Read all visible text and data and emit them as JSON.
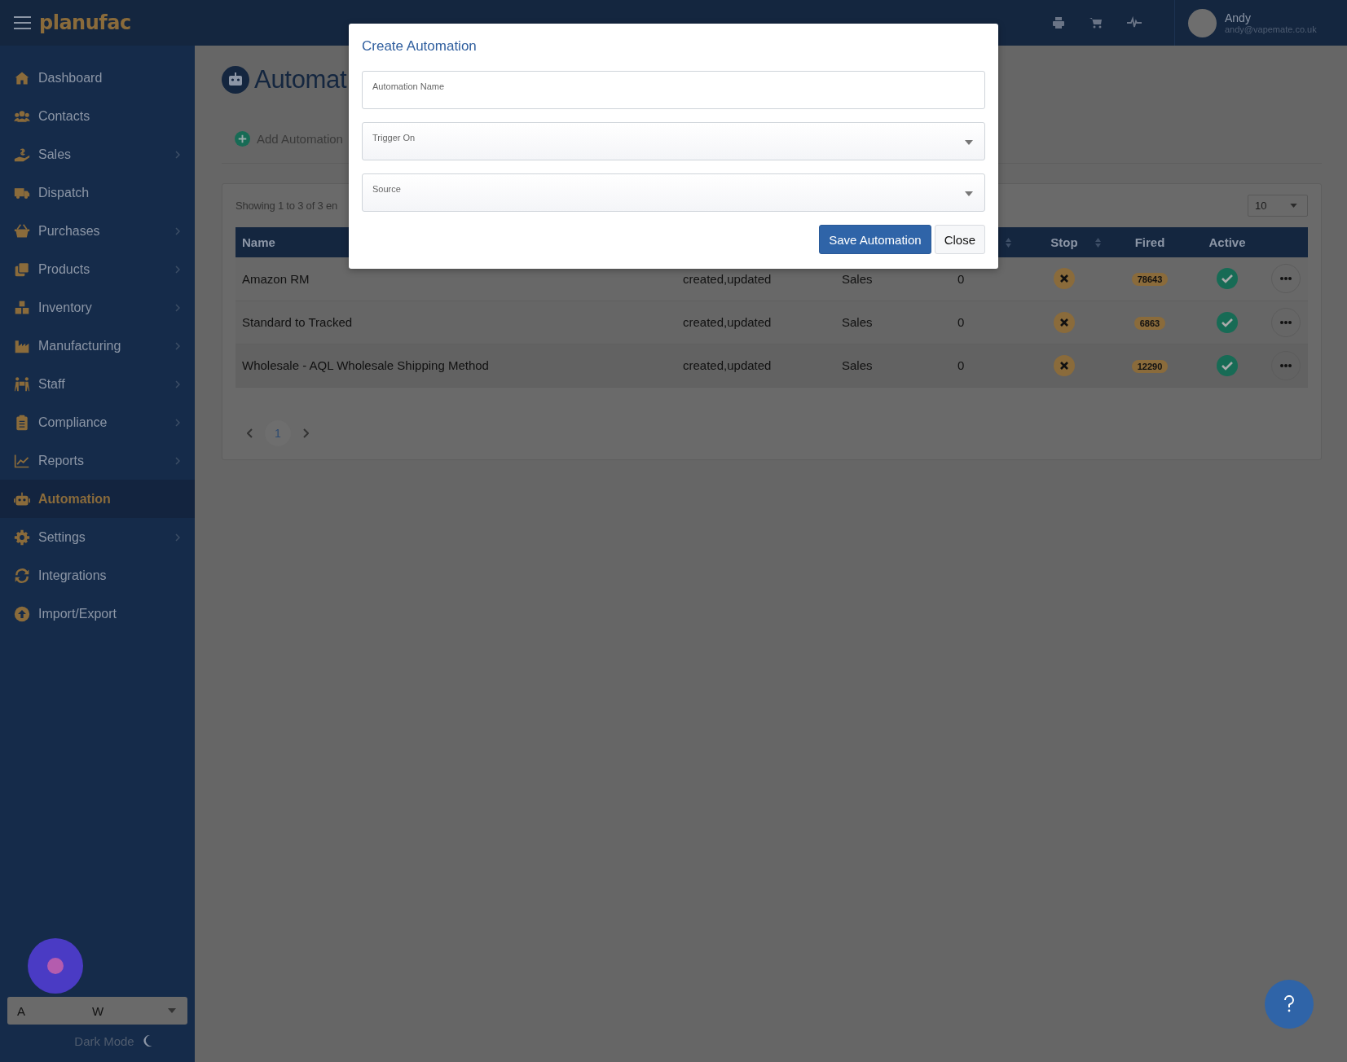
{
  "header": {
    "logo": "planufac",
    "user": {
      "name": "Andy",
      "email": "andy@vapemate.co.uk"
    }
  },
  "sidebar": {
    "items": [
      {
        "label": "Dashboard",
        "has_submenu": false,
        "selected": false
      },
      {
        "label": "Contacts",
        "has_submenu": false,
        "selected": false
      },
      {
        "label": "Sales",
        "has_submenu": true,
        "selected": false
      },
      {
        "label": "Dispatch",
        "has_submenu": false,
        "selected": false
      },
      {
        "label": "Purchases",
        "has_submenu": true,
        "selected": false
      },
      {
        "label": "Products",
        "has_submenu": true,
        "selected": false
      },
      {
        "label": "Inventory",
        "has_submenu": true,
        "selected": false
      },
      {
        "label": "Manufacturing",
        "has_submenu": true,
        "selected": false
      },
      {
        "label": "Staff",
        "has_submenu": true,
        "selected": false
      },
      {
        "label": "Compliance",
        "has_submenu": true,
        "selected": false
      },
      {
        "label": "Reports",
        "has_submenu": true,
        "selected": false
      },
      {
        "label": "Automation",
        "has_submenu": false,
        "selected": true
      },
      {
        "label": "Settings",
        "has_submenu": true,
        "selected": false
      },
      {
        "label": "Integrations",
        "has_submenu": false,
        "selected": false
      },
      {
        "label": "Import/Export",
        "has_submenu": false,
        "selected": false
      }
    ],
    "location_select": {
      "value_start": "A",
      "value_end": "W"
    },
    "dark_mode": {
      "label": "Dark Mode"
    }
  },
  "page": {
    "title": "Automat",
    "add_button": "Add Automation"
  },
  "table": {
    "info": "Showing 1 to 3 of 3 en",
    "page_size": "10",
    "columns": [
      {
        "label": "Name",
        "sortable": false
      },
      {
        "sortable": false
      },
      {
        "sortable": false
      },
      {
        "sortable": true
      },
      {
        "label": "Stop",
        "sortable": true
      },
      {
        "label": "Fired",
        "sortable": false
      },
      {
        "label": "Active",
        "sortable": false
      }
    ],
    "rows": [
      {
        "name": "Amazon RM",
        "trigger": "created,updated",
        "source": "Sales",
        "column_4": "0",
        "stop": false,
        "fired": "78643",
        "active": true
      },
      {
        "name": "Standard to Tracked",
        "trigger": "created,updated",
        "source": "Sales",
        "column_4": "0",
        "stop": false,
        "fired": "6863",
        "active": true
      },
      {
        "name": "Wholesale - AQL Wholesale Shipping Method",
        "trigger": "created,updated",
        "source": "Sales",
        "column_4": "0",
        "stop": false,
        "fired": "12290",
        "active": true
      }
    ],
    "pagination": {
      "pages": [
        {
          "label": "1",
          "selected": true
        }
      ]
    }
  },
  "modal": {
    "title": "Create Automation",
    "fields": [
      {
        "label": "Automation Name",
        "kind": "text"
      },
      {
        "label": "Trigger On",
        "kind": "select"
      },
      {
        "label": "Source",
        "kind": "select"
      }
    ],
    "buttons": [
      {
        "label": "Save Automation",
        "kind": "primary"
      },
      {
        "label": "Close",
        "kind": "secondary"
      }
    ]
  }
}
